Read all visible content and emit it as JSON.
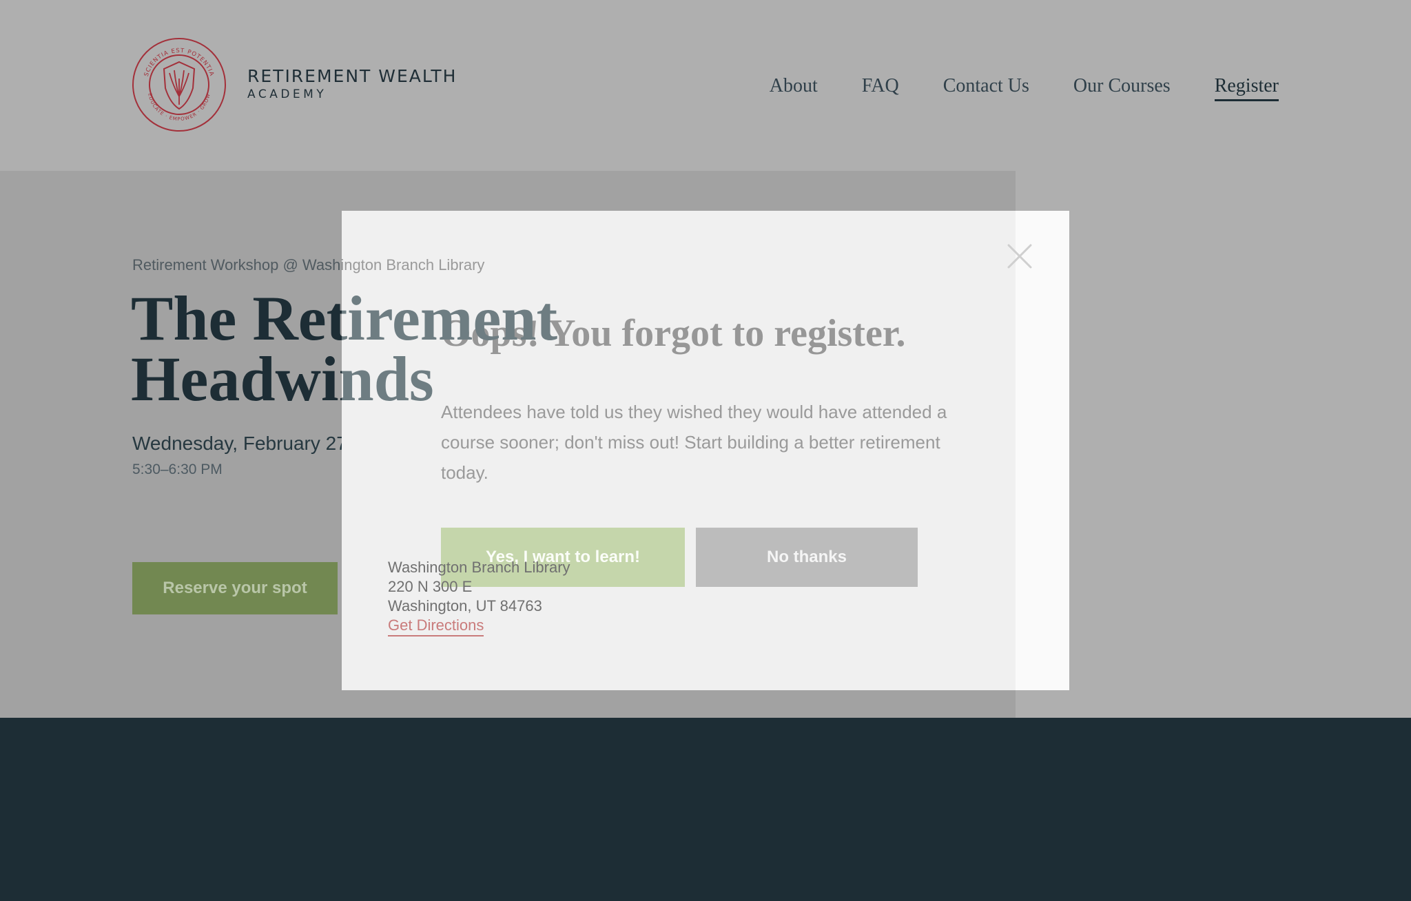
{
  "header": {
    "brand_name": "RETIREMENT WEALTH",
    "brand_sub": "ACADEMY",
    "logo_ring_top": "SCIENTIA EST POTENTIA",
    "logo_ring_bottom": "EDUCATE · EMPOWER · GROW",
    "nav": [
      {
        "label": "About"
      },
      {
        "label": "FAQ"
      },
      {
        "label": "Contact Us"
      },
      {
        "label": "Our Courses"
      },
      {
        "label": "Register",
        "active": true
      }
    ]
  },
  "hero": {
    "eyebrow": "Retirement Workshop @ Washington Branch Library",
    "title_line1": "The Retirement",
    "title_line2": "Headwinds",
    "date": "Wednesday, February 27",
    "time": "5:30–6:30 PM",
    "reserve_label": "Reserve your spot"
  },
  "location": {
    "name": "Washington Branch Library",
    "street": "220 N 300 E",
    "city": "Washington, UT 84763",
    "directions_label": "Get Directions"
  },
  "modal": {
    "title": "Oops! You forgot to register.",
    "body": "Attendees have told us they wished they would have attended a course sooner; don't miss out! Start building a better retirement today.",
    "yes_label": "Yes, I want to learn!",
    "no_label": "No thanks",
    "close_icon": "close-icon"
  },
  "colors": {
    "navy": "#1d2d35",
    "brand_red": "#a3303a",
    "green": "#728851",
    "green_light": "#c5d6ab"
  }
}
